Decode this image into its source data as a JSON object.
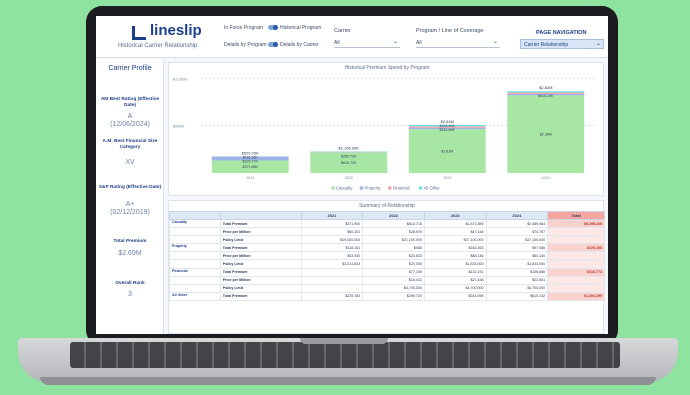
{
  "header": {
    "logo": "lineslip",
    "subtitle": "Historical Carrier Relationship",
    "toggles": [
      {
        "left": "In Force Program",
        "right": "Historical Program"
      },
      {
        "left": "Details by Program",
        "right": "Details by Carrier"
      }
    ],
    "carrier": {
      "label": "Carrier",
      "value": "All"
    },
    "program": {
      "label": "Program / Line of Coverage",
      "value": "All"
    },
    "page_nav": {
      "label": "PAGE NAVIGATION",
      "value": "Carrier Relationship"
    }
  },
  "sidebar": {
    "title": "Carrier Profile",
    "fields": [
      {
        "label": "AM Best Rating (Effective Date)",
        "value": "A",
        "sub": "(12/06/2024)"
      },
      {
        "label": "A.M. Best Financial Size Category",
        "value": "XV",
        "sub": ""
      },
      {
        "label": "S&P Rating (Effective Date)",
        "value": "A+",
        "sub": "(02/12/2019)"
      },
      {
        "label": "Total Premium",
        "value": "$2.69M",
        "sub": ""
      },
      {
        "label": "Overall Rank",
        "value": "3",
        "sub": ""
      }
    ]
  },
  "chart_title": "Historical Premium Spend by Program",
  "chart_data": {
    "type": "bar",
    "stacked": true,
    "categories": [
      "2021",
      "2022",
      "2023",
      "2024"
    ],
    "y_ticks": [
      "$1,000K",
      "$500K"
    ],
    "series": [
      {
        "name": "Casualty",
        "color": "#a8e6a3",
        "values": [
          371,
          610,
          1300,
          2300
        ]
      },
      {
        "name": "Property",
        "color": "#9fb4e6",
        "values": [
          118,
          10,
          40,
          40
        ]
      },
      {
        "name": "Financial",
        "color": "#f2a3a3",
        "values": [
          0,
          10,
          40,
          40
        ]
      },
      {
        "name": "All Other",
        "color": "#6fe0e8",
        "values": [
          0,
          10,
          40,
          40
        ]
      }
    ],
    "totals": [
      "$520.25K",
      "$1,196.90K",
      "$2.64M",
      "$2.82M"
    ],
    "segment_labels": [
      [
        "$371.86K",
        "$118.16K",
        "$229.77K"
      ],
      [
        "$610.72K",
        "",
        "$259.72K"
      ],
      [
        "$1.61M",
        "$163.46K",
        "$344.69K"
      ],
      [
        "$2.38M",
        "",
        "$615.14K"
      ]
    ],
    "legend": "bottom-center"
  },
  "table": {
    "title": "Summary of Relationship",
    "columns": [
      "",
      "",
      "2021",
      "2022",
      "2023",
      "2024",
      "Total"
    ],
    "groups": [
      {
        "category": "Casualty",
        "rows": [
          {
            "metric": "Total Premium",
            "values": [
              "$371,900",
              "$610,716",
              "$1,871,859",
              "$2,489,464"
            ],
            "total": "$5,298,169"
          },
          {
            "metric": "Price per Million",
            "values": [
              "$50,101",
              "$28,976",
              "$47,448",
              "$74,767"
            ],
            "total": ""
          },
          {
            "metric": "Policy Limit",
            "values": [
              "$19,000,000",
              "$21,100,000",
              "$37,100,000",
              "$37,100,000"
            ],
            "total": ""
          }
        ]
      },
      {
        "category": "Property",
        "rows": [
          {
            "metric": "Total Premium",
            "values": [
              "$118,161",
              "$485",
              "$162,463",
              "$97,086"
            ],
            "total": "$378,195"
          },
          {
            "metric": "Price per Million",
            "values": [
              "$53,930",
              "$23,833",
              "$88,146",
              "$53,140"
            ],
            "total": ""
          },
          {
            "metric": "Policy Limit",
            "values": [
              "$2,214,833",
              "$20,000",
              "$1,833,000",
              "$1,833,000"
            ],
            "total": ""
          }
        ]
      },
      {
        "category": "Financial",
        "rows": [
          {
            "metric": "Total Premium",
            "values": [
              "",
              "$77,159",
              "$132,151",
              "$106,686"
            ],
            "total": "$316,774"
          },
          {
            "metric": "Price per Million",
            "values": [
              "",
              "$16,432",
              "$27,438",
              "$22,661"
            ],
            "total": ""
          },
          {
            "metric": "Policy Limit",
            "values": [
              "",
              "$4,700,000",
              "$4,700,000",
              "$4,700,000"
            ],
            "total": ""
          }
        ]
      },
      {
        "category": "All Other",
        "rows": [
          {
            "metric": "Total Premium",
            "values": [
              "$229,783",
              "$299,720",
              "$344,695",
              "$615,142"
            ],
            "total": "$1,394,299"
          }
        ]
      }
    ]
  }
}
